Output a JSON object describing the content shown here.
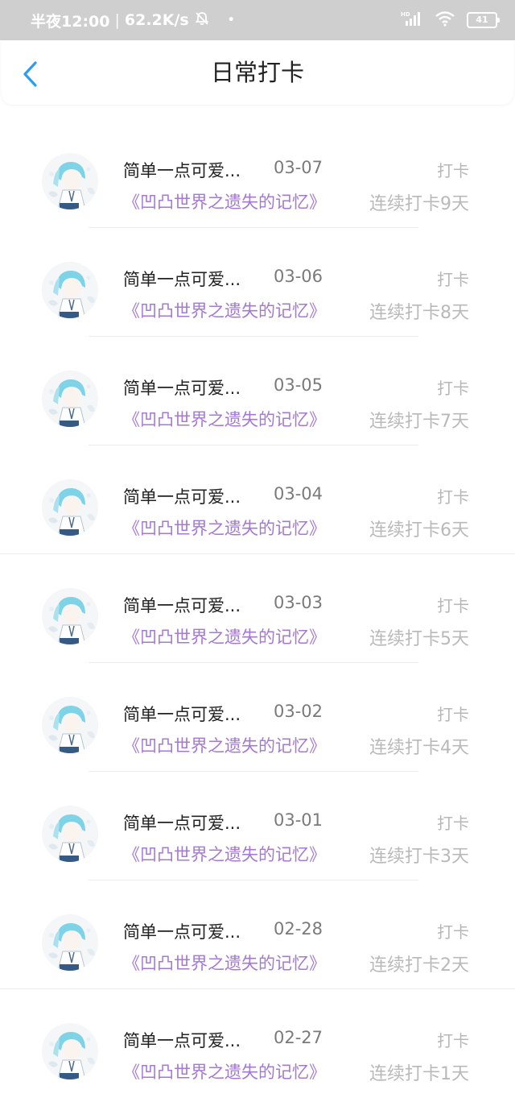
{
  "status_bar": {
    "time": "半夜12:00",
    "speed": "62.2K/s",
    "battery": "41",
    "network": "HD"
  },
  "header": {
    "title": "日常打卡"
  },
  "colors": {
    "book_title": "#a479d3",
    "back_arrow": "#2e9cf0",
    "status_bar_bg": "#cfcfcf"
  },
  "items": [
    {
      "name": "简单一点可爱...",
      "date": "03-07",
      "action": "打卡",
      "book": "《凹凸世界之遗失的记忆》",
      "streak": "连续打卡9天"
    },
    {
      "name": "简单一点可爱...",
      "date": "03-06",
      "action": "打卡",
      "book": "《凹凸世界之遗失的记忆》",
      "streak": "连续打卡8天"
    },
    {
      "name": "简单一点可爱...",
      "date": "03-05",
      "action": "打卡",
      "book": "《凹凸世界之遗失的记忆》",
      "streak": "连续打卡7天"
    },
    {
      "name": "简单一点可爱...",
      "date": "03-04",
      "action": "打卡",
      "book": "《凹凸世界之遗失的记忆》",
      "streak": "连续打卡6天"
    },
    {
      "name": "简单一点可爱...",
      "date": "03-03",
      "action": "打卡",
      "book": "《凹凸世界之遗失的记忆》",
      "streak": "连续打卡5天"
    },
    {
      "name": "简单一点可爱...",
      "date": "03-02",
      "action": "打卡",
      "book": "《凹凸世界之遗失的记忆》",
      "streak": "连续打卡4天"
    },
    {
      "name": "简单一点可爱...",
      "date": "03-01",
      "action": "打卡",
      "book": "《凹凸世界之遗失的记忆》",
      "streak": "连续打卡3天"
    },
    {
      "name": "简单一点可爱...",
      "date": "02-28",
      "action": "打卡",
      "book": "《凹凸世界之遗失的记忆》",
      "streak": "连续打卡2天"
    },
    {
      "name": "简单一点可爱...",
      "date": "02-27",
      "action": "打卡",
      "book": "《凹凸世界之遗失的记忆》",
      "streak": "连续打卡1天"
    }
  ]
}
